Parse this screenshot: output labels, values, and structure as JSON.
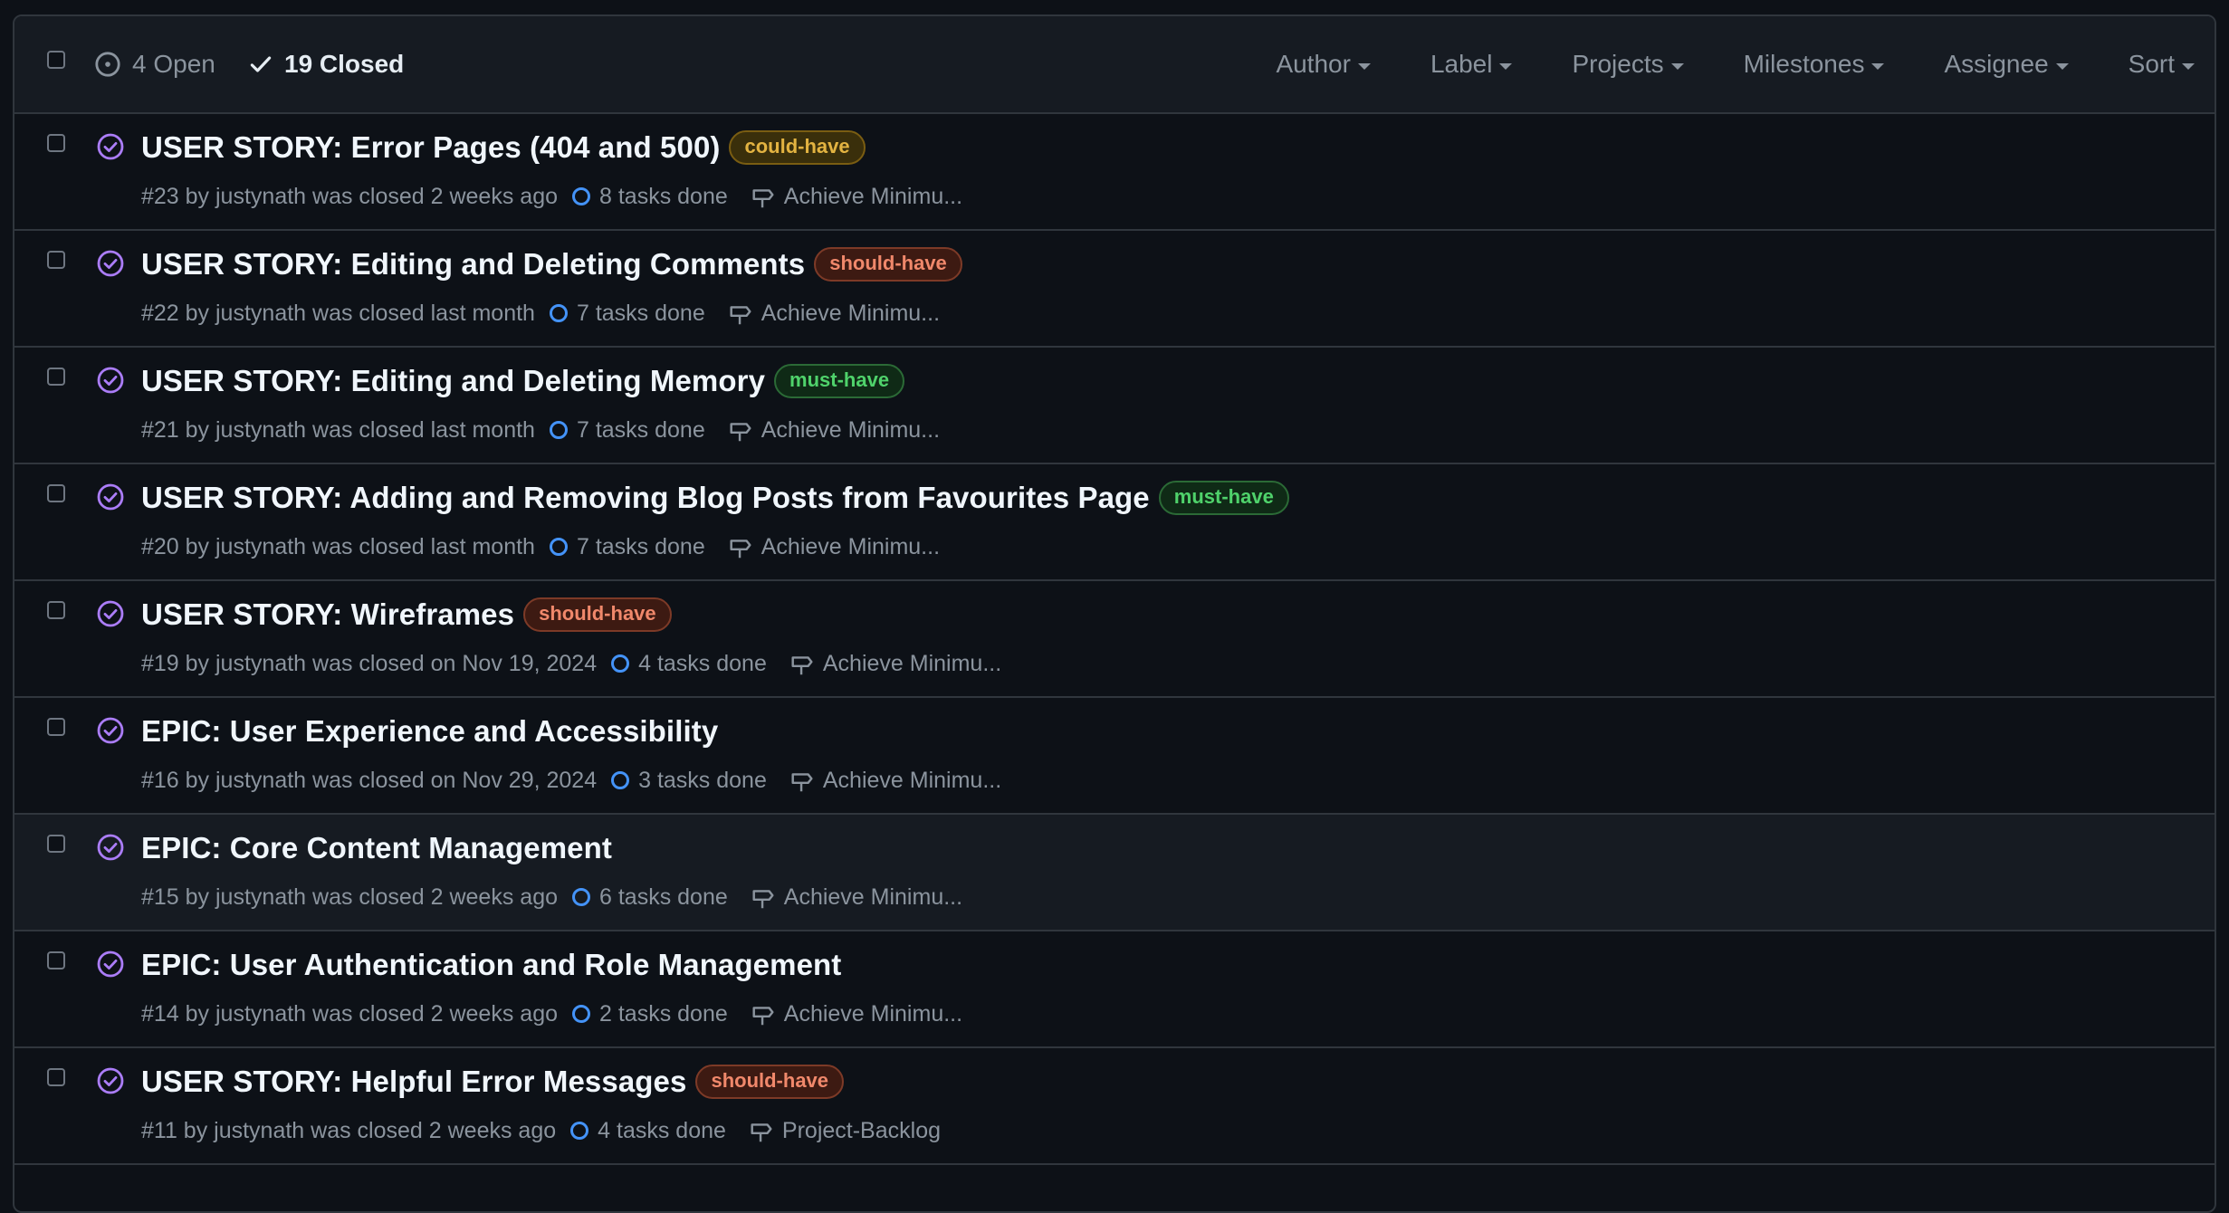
{
  "header": {
    "open_label": "4 Open",
    "closed_label": "19 Closed",
    "filters": [
      "Author",
      "Label",
      "Projects",
      "Milestones",
      "Assignee",
      "Sort"
    ]
  },
  "label_colors": {
    "could-have": {
      "text": "#e3b341",
      "bg": "#3a2f0b",
      "border": "#7a5d12"
    },
    "should-have": {
      "text": "#f0886b",
      "bg": "#3d1a12",
      "border": "#7d3a27"
    },
    "must-have": {
      "text": "#4fd26b",
      "bg": "#0f2a16",
      "border": "#2b6a36"
    }
  },
  "issues": [
    {
      "title": "USER STORY: Error Pages (404 and 500)",
      "label": "could-have",
      "meta": "#23 by justynath was closed 2 weeks ago",
      "tasks": "8 tasks done",
      "milestone": "Achieve Minimu..."
    },
    {
      "title": "USER STORY: Editing and Deleting Comments",
      "label": "should-have",
      "meta": "#22 by justynath was closed last month",
      "tasks": "7 tasks done",
      "milestone": "Achieve Minimu..."
    },
    {
      "title": "USER STORY: Editing and Deleting Memory",
      "label": "must-have",
      "meta": "#21 by justynath was closed last month",
      "tasks": "7 tasks done",
      "milestone": "Achieve Minimu..."
    },
    {
      "title": "USER STORY: Adding and Removing Blog Posts from Favourites Page",
      "label": "must-have",
      "meta": "#20 by justynath was closed last month",
      "tasks": "7 tasks done",
      "milestone": "Achieve Minimu..."
    },
    {
      "title": "USER STORY: Wireframes",
      "label": "should-have",
      "meta": "#19 by justynath was closed on Nov 19, 2024",
      "tasks": "4 tasks done",
      "milestone": "Achieve Minimu..."
    },
    {
      "title": "EPIC: User Experience and Accessibility",
      "label": "",
      "meta": "#16 by justynath was closed on Nov 29, 2024",
      "tasks": "3 tasks done",
      "milestone": "Achieve Minimu..."
    },
    {
      "title": "EPIC: Core Content Management",
      "label": "",
      "meta": "#15 by justynath was closed 2 weeks ago",
      "tasks": "6 tasks done",
      "milestone": "Achieve Minimu..."
    },
    {
      "title": "EPIC: User Authentication and Role Management",
      "label": "",
      "meta": "#14 by justynath was closed 2 weeks ago",
      "tasks": "2 tasks done",
      "milestone": "Achieve Minimu..."
    },
    {
      "title": "USER STORY: Helpful Error Messages",
      "label": "should-have",
      "meta": "#11 by justynath was closed 2 weeks ago",
      "tasks": "4 tasks done",
      "milestone": "Project-Backlog"
    }
  ],
  "highlighted_row": 6
}
